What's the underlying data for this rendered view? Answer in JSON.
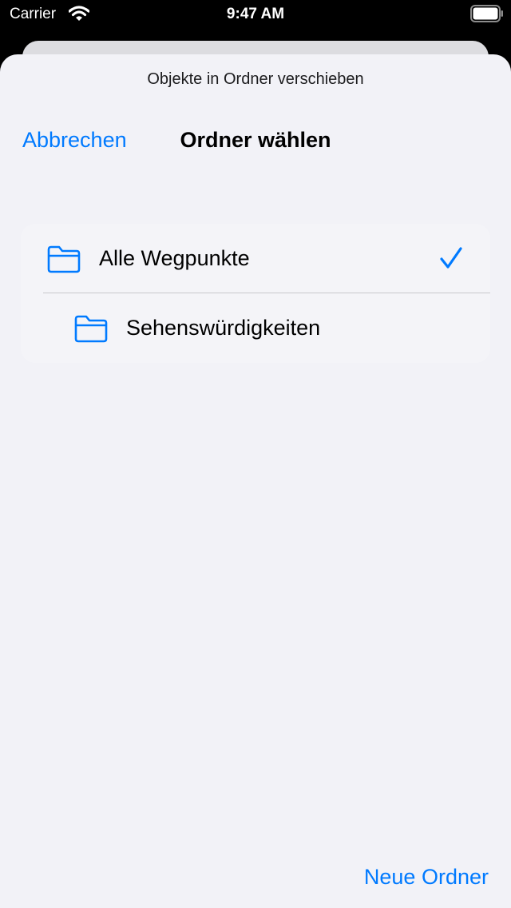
{
  "status_bar": {
    "carrier": "Carrier",
    "time": "9:47 AM",
    "wifi_icon": "wifi-icon",
    "battery_icon": "battery-icon"
  },
  "sheet": {
    "prompt": "Objekte in Ordner verschieben"
  },
  "nav": {
    "cancel_label": "Abbrechen",
    "title": "Ordner wählen"
  },
  "folders": [
    {
      "label": "Alle Wegpunkte",
      "icon": "folder-icon",
      "selected": true,
      "level": 0
    },
    {
      "label": "Sehenswürdigkeiten",
      "icon": "folder-icon",
      "selected": false,
      "level": 1
    }
  ],
  "footer": {
    "new_folder_label": "Neue Ordner"
  },
  "colors": {
    "accent": "#007aff",
    "background": "#f2f2f7",
    "status_bar": "#000000"
  }
}
